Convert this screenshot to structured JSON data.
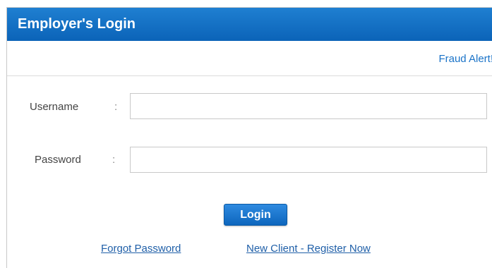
{
  "header": {
    "title": "Employer's Login"
  },
  "links": {
    "fraud_alert": "Fraud Alert!",
    "forgot_password": "Forgot Password",
    "register": "New Client - Register Now"
  },
  "form": {
    "username_label": "Username",
    "password_label": "Password",
    "colon": ":",
    "username_value": "",
    "password_value": "",
    "login_label": "Login"
  },
  "colors": {
    "header_bg": "#0b63b8",
    "link": "#1a73c8",
    "button_bg": "#0d66bd"
  }
}
